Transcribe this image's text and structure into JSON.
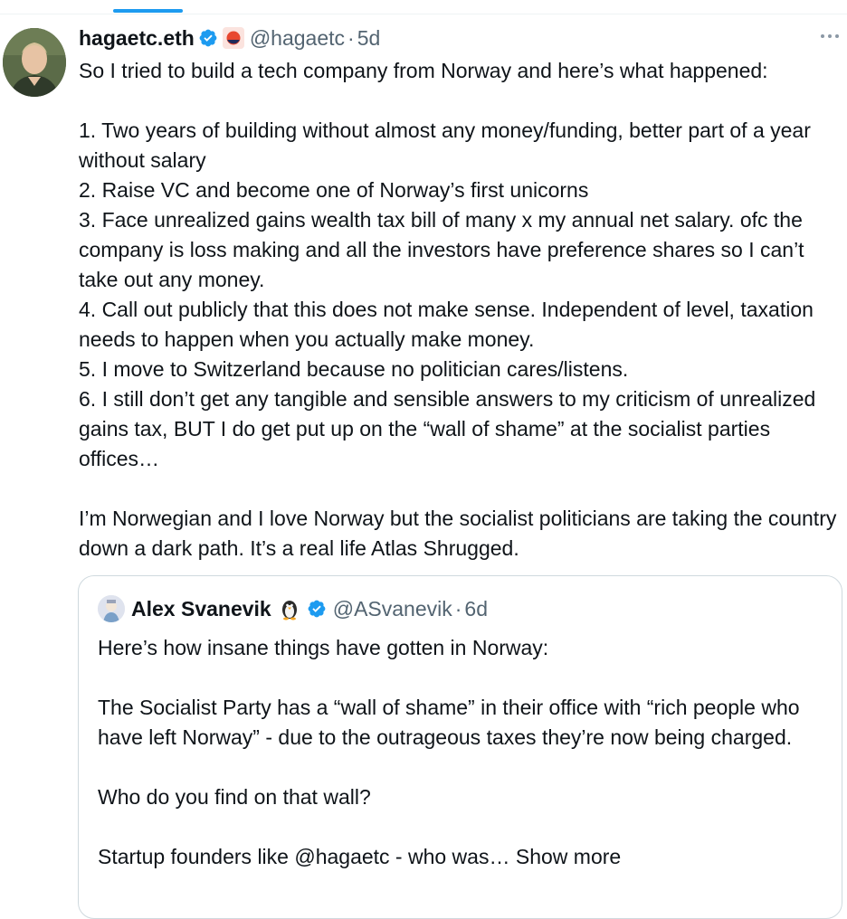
{
  "colors": {
    "accent": "#1d9bf0",
    "text": "#0f1419",
    "secondary_text": "#536471",
    "border": "#cfd9de"
  },
  "tweet": {
    "display_name": "hagaetc.eth",
    "handle": "@hagaetc",
    "separator": "·",
    "time": "5d",
    "verified_icon": "verified-badge-icon",
    "affiliation_icon": "affiliate-logo-icon",
    "more_icon": "more-options-icon",
    "text": "So I tried to build a tech company from Norway and here’s what happened:\n\n1. Two years of building without almost any money/funding, better part of a year without salary\n2. Raise VC and become one of Norway’s first unicorns\n3. Face unrealized gains wealth tax bill of many x my annual net salary. ofc the company is loss making and all the investors have preference shares so I can’t take out any money.\n4. Call out publicly that this does not make sense. Independent of level, taxation needs to happen when you actually make money.\n5. I move to Switzerland because no politician cares/listens.\n6. I still don’t get any tangible and sensible answers to my criticism of unrealized gains tax, BUT I do get put up on the “wall of shame” at the socialist parties offices…\n\nI’m Norwegian and I love Norway but the socialist politicians are taking the country down a dark path. It’s a real life Atlas Shrugged."
  },
  "quoted_tweet": {
    "display_name": "Alex Svanevik",
    "name_emoji_icon": "penguin-emoji-icon",
    "verified_icon": "verified-badge-icon",
    "handle": "@ASvanevik",
    "separator": "·",
    "time": "6d",
    "text": "Here’s how insane things have gotten in Norway:\n\nThe Socialist Party has a “wall of shame” in their office with “rich people who have left Norway” - due to the outrageous taxes they’re now being charged.\n\nWho do you find on that wall?\n\nStartup founders like @hagaetc - who was… ",
    "show_more": "Show more"
  }
}
